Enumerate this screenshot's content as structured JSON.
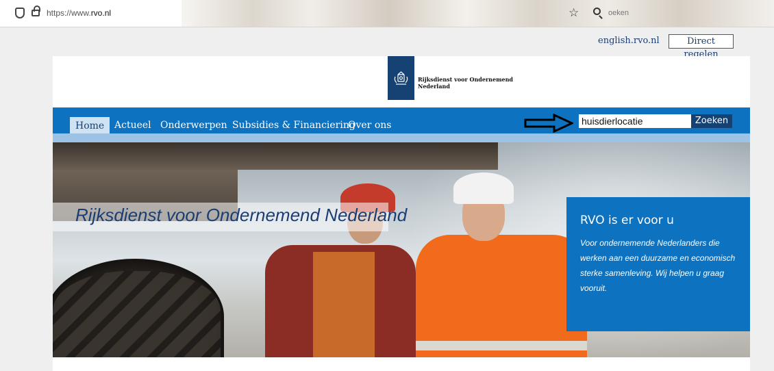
{
  "browser": {
    "url_prefix": "https://www.",
    "url_domain": "rvo.nl",
    "search_placeholder": "oeken"
  },
  "utility": {
    "english_link": "english.rvo.nl",
    "direct_button": "Direct regelen"
  },
  "logo": {
    "line1": "Rijksdienst voor Ondernemend",
    "line2": "Nederland"
  },
  "nav": {
    "items": [
      "Home",
      "Actueel",
      "Onderwerpen",
      "Subsidies & Financiering",
      "Over ons"
    ],
    "search_value": "huisdierlocatie",
    "search_button": "Zoeken"
  },
  "hero": {
    "title": "Rijksdienst voor Ondernemend Nederland",
    "box_title": "RVO is er voor u",
    "box_text": "Voor ondernemende Nederlanders die werken aan een duurzame en economisch sterke samenleving. Wij helpen u graag vooruit."
  },
  "colors": {
    "nav_blue": "#0d72c0",
    "logo_blue": "#154273",
    "nav_strip": "#9cc3e6"
  },
  "icons": [
    "shield-icon",
    "lock-icon",
    "bookmark-star-icon",
    "search-icon",
    "crest-icon",
    "arrow-icon"
  ]
}
